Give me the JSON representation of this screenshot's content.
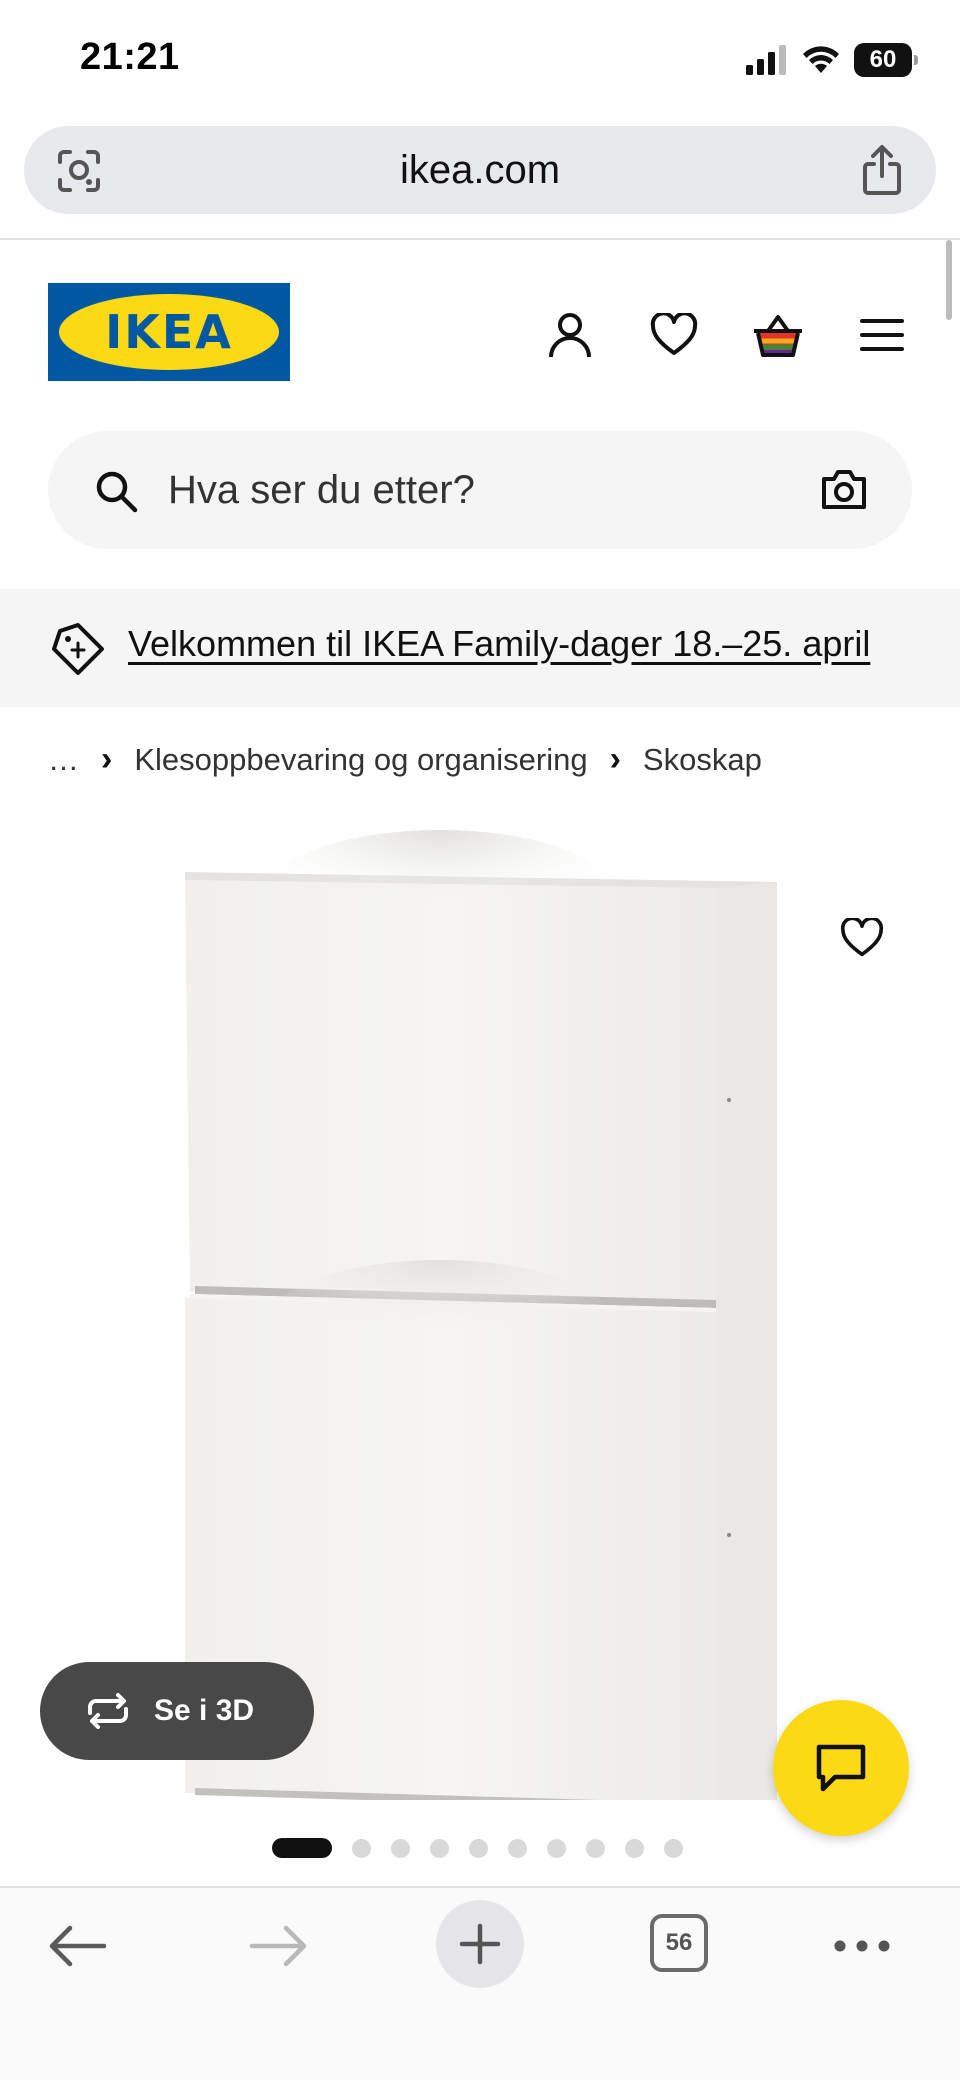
{
  "status_bar": {
    "time": "21:21",
    "battery": "60"
  },
  "browser": {
    "url": "ikea.com",
    "tab_count": "56"
  },
  "header": {
    "logo_text": "IKEA",
    "icons": [
      "user-icon",
      "heart-icon",
      "basket-icon",
      "menu-icon"
    ]
  },
  "search": {
    "placeholder": "Hva ser du etter?"
  },
  "promo": {
    "text": "Velkommen til IKEA Family-dager 18.–25. april"
  },
  "breadcrumb": {
    "ellipsis": "…",
    "items": [
      "Klesoppbevaring og organisering",
      "Skoskap"
    ]
  },
  "product": {
    "view_3d_label": "Se i 3D",
    "carousel": {
      "total": 10,
      "active_index": 0
    }
  },
  "colors": {
    "ikea_blue": "#0058a3",
    "ikea_yellow": "#fbd914",
    "search_bg": "#f5f5f5",
    "promo_bg": "#f5f5f5"
  }
}
